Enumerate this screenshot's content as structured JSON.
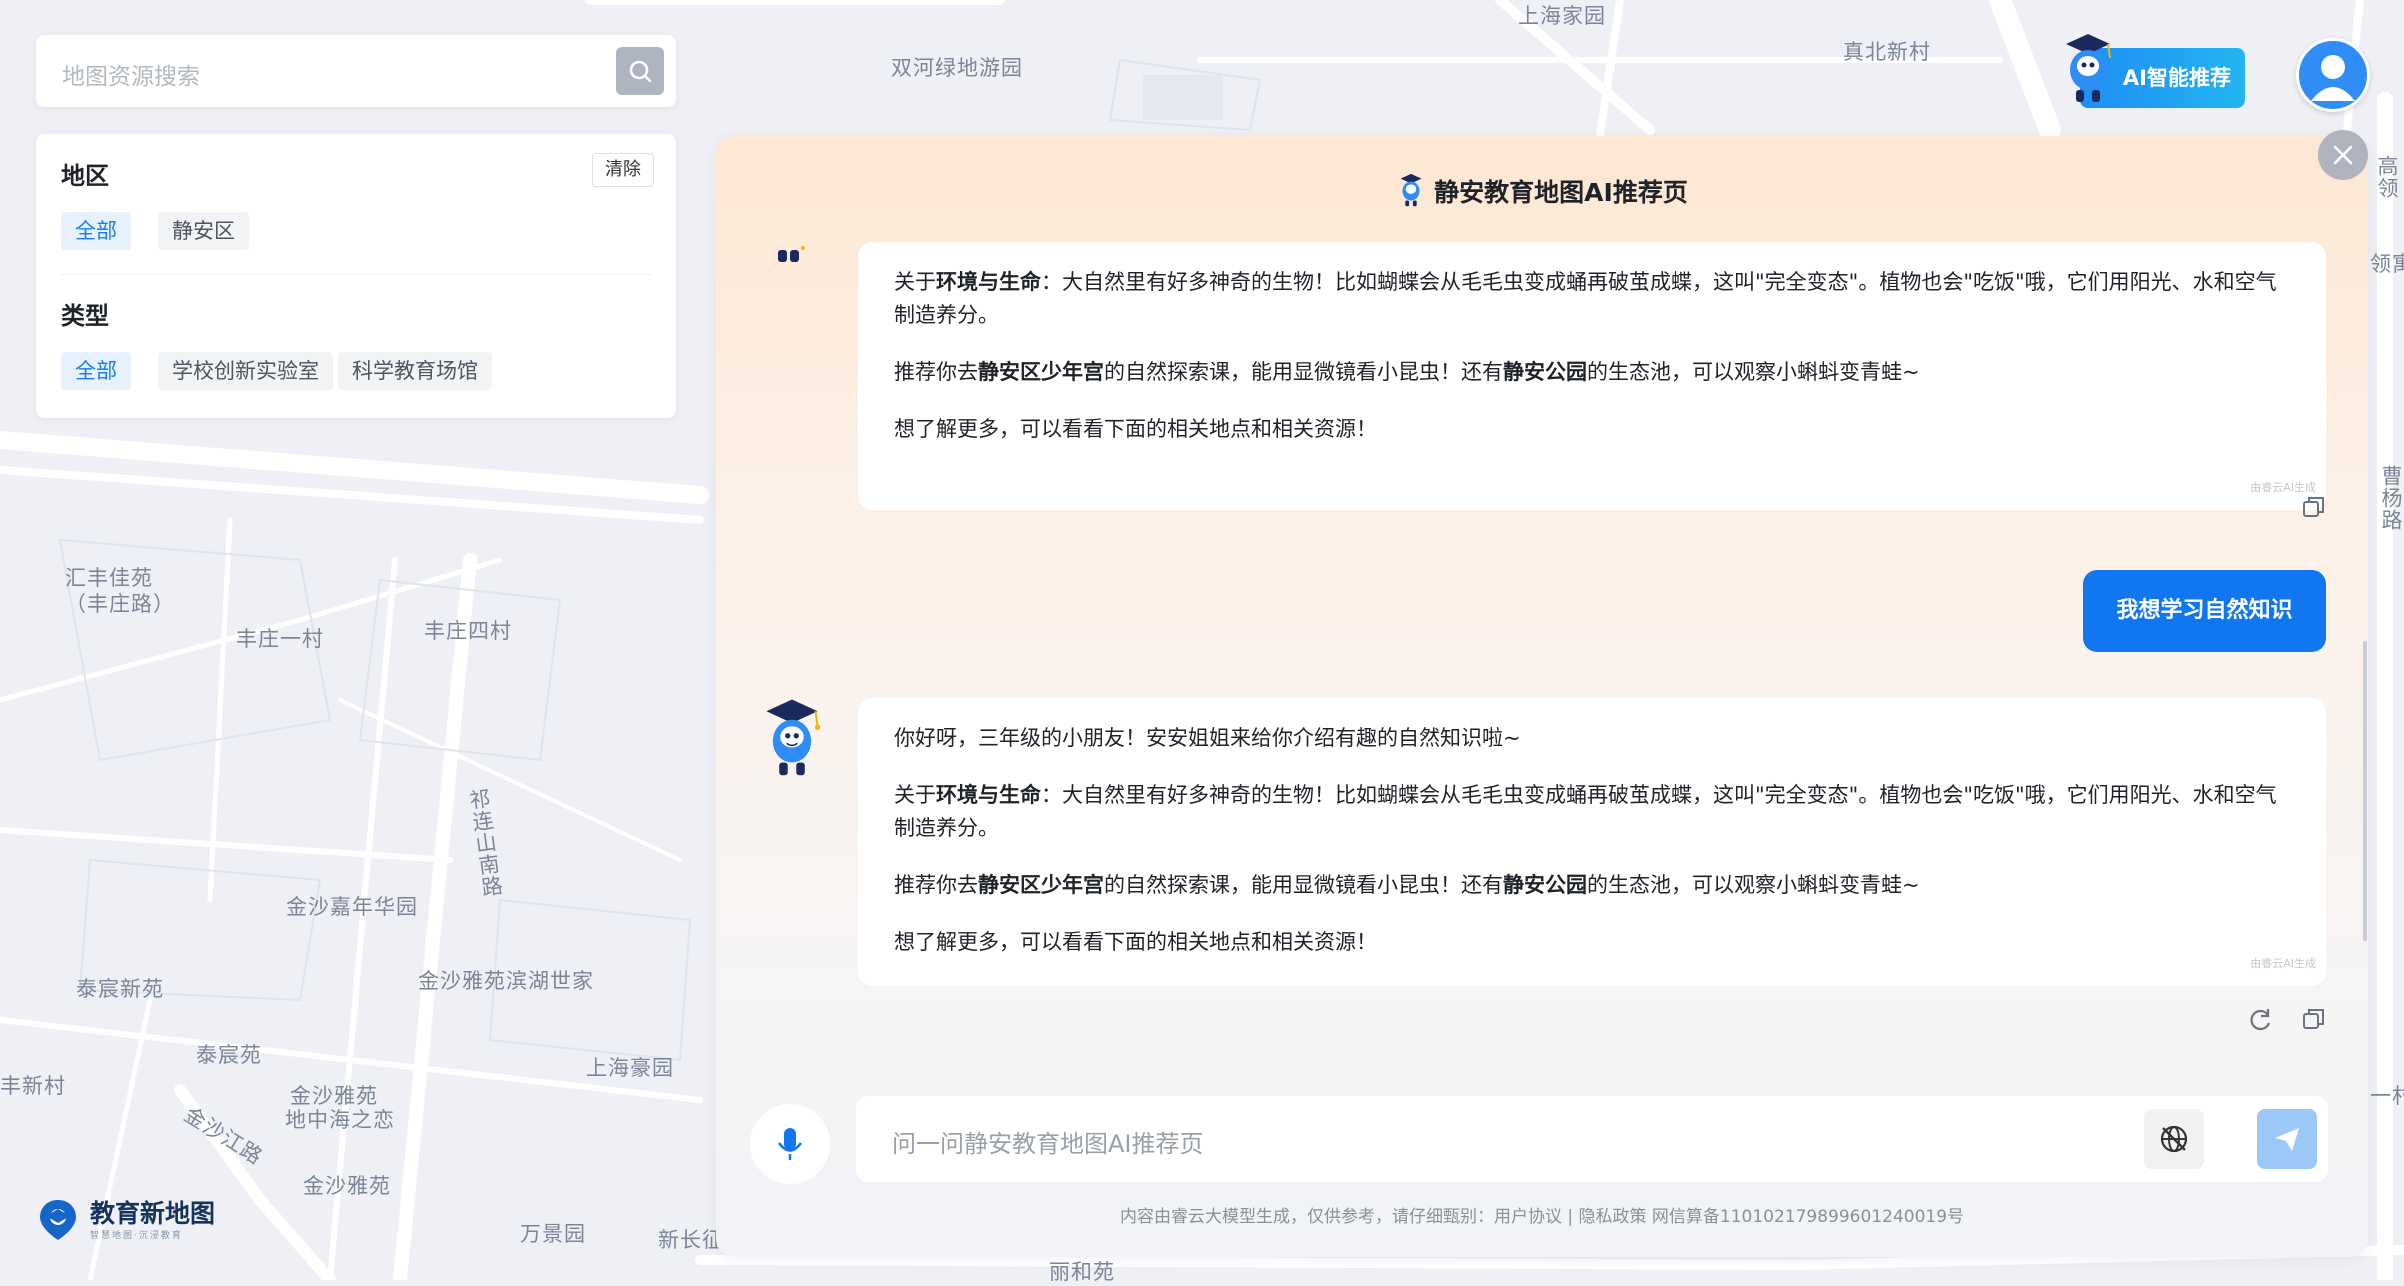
{
  "map": {
    "labels": [
      "上海家园",
      "真北新村",
      "双河绿地游园",
      "汇丰佳苑",
      "（丰庄路）",
      "丰庄一村",
      "丰庄四村",
      "祁连山南路",
      "金沙嘉年华园",
      "泰宸新苑",
      "金沙雅苑滨湖世家",
      "泰宸苑",
      "上海豪园",
      "丰新村",
      "金沙雅苑",
      "地中海之恋",
      "金沙江路",
      "金沙雅苑",
      "万景园",
      "新长征",
      "丽和苑",
      "领寓",
      "曹杨路",
      "高领",
      "一村"
    ]
  },
  "search": {
    "placeholder": "地图资源搜索",
    "icon": "search-icon"
  },
  "filter": {
    "region_title": "地区",
    "clear_label": "清除",
    "regions": [
      "全部",
      "静安区"
    ],
    "type_title": "类型",
    "types": [
      "全部",
      "学校创新实验室",
      "科学教育场馆"
    ]
  },
  "header": {
    "ai_button_label": "AI智能推荐"
  },
  "chat": {
    "title": "静安教育地图AI推荐页",
    "generated_by": "由睿云AI生成",
    "first_answer": {
      "p1_prefix": "关于",
      "p1_bold": "环境与生命",
      "p1_text": "：大自然里有好多神奇的生物！比如蝴蝶会从毛毛虫变成蛹再破茧成蝶，这叫\"完全变态\"。植物也会\"吃饭\"哦，它们用阳光、水和空气制造养分。",
      "p2_prefix": "推荐你去",
      "p2_bold1": "静安区少年宫",
      "p2_mid": "的自然探索课，能用显微镜看小昆虫！还有",
      "p2_bold2": "静安公园",
      "p2_end": "的生态池，可以观察小蝌蚪变青蛙~",
      "p3": "想了解更多，可以看看下面的相关地点和相关资源！"
    },
    "user_message": "我想学习自然知识",
    "second_answer": {
      "p0": "你好呀，三年级的小朋友！安安姐姐来给你介绍有趣的自然知识啦~",
      "p1_prefix": "关于",
      "p1_bold": "环境与生命",
      "p1_text": "：大自然里有好多神奇的生物！比如蝴蝶会从毛毛虫变成蛹再破茧成蝶，这叫\"完全变态\"。植物也会\"吃饭\"哦，它们用阳光、水和空气制造养分。",
      "p2_prefix": "推荐你去",
      "p2_bold1": "静安区少年宫",
      "p2_mid": "的自然探索课，能用显微镜看小昆虫！还有",
      "p2_bold2": "静安公园",
      "p2_end": "的生态池，可以观察小蝌蚪变青蛙~",
      "p3": "想了解更多，可以看看下面的相关地点和相关资源！"
    },
    "input_placeholder": "问一问静安教育地图AI推荐页",
    "footer": "内容由睿云大模型生成，仅供参考，请仔细甄别：用户协议 | 隐私政策 网信算备110102179899601240019号"
  },
  "logo": {
    "name": "教育新地图",
    "tagline": "智慧地图·沉浸教育"
  },
  "colors": {
    "accent": "#1177f0",
    "chip_active": "#1a7cf0",
    "panel_top": "#fde7d3"
  }
}
